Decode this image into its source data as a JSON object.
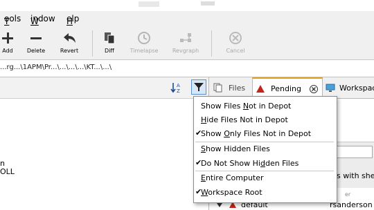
{
  "menu": {
    "tools": "Tools",
    "window": "Window",
    "help": "Help"
  },
  "toolbar": {
    "add": "Add",
    "delete": "Delete",
    "revert": "Revert",
    "diff": "Diff",
    "timelapse": "Timelapse",
    "revgraph": "Revgraph",
    "cancel": "Cancel"
  },
  "path": {
    "text": "...rg...\\1APM\\Pr...\\...\\...\\...\\KT...\\...\\"
  },
  "tabs": {
    "files": "Files",
    "pending": "Pending",
    "workspace": "Workspac"
  },
  "filter_menu": {
    "items": [
      {
        "pre": "Show Files ",
        "u": "N",
        "post": "ot in Depot",
        "checked": false
      },
      {
        "pre": "",
        "u": "H",
        "post": "ide Files Not in Depot",
        "checked": false
      },
      {
        "pre": "Show ",
        "u": "O",
        "post": "nly Files Not in Depot",
        "checked": true
      },
      {
        "pre": "",
        "u": "S",
        "post": "how Hidden Files",
        "checked": false
      },
      {
        "pre": "Do Not Show Hi",
        "u": "d",
        "post": "den Files",
        "checked": true
      },
      {
        "pre": "",
        "u": "E",
        "post": "ntire Computer",
        "checked": false
      },
      {
        "pre": "",
        "u": "W",
        "post": "orkspace Root",
        "checked": true
      }
    ]
  },
  "left_fragments": {
    "a": "n",
    "b": "OLL"
  },
  "right_fragments": {
    "shelve": "s with shelv",
    "default_label": "default",
    "user": "rsanderson",
    "er": "er"
  },
  "colors": {
    "pending_icon": "#c0261c",
    "accent": "#5a8fd0"
  }
}
